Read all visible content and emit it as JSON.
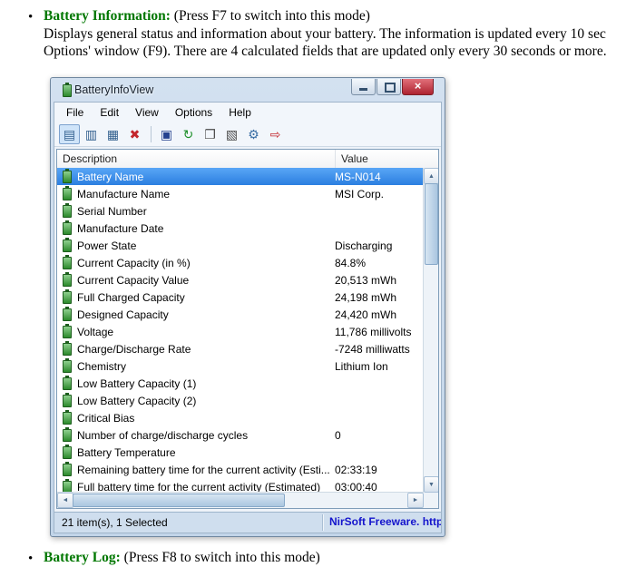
{
  "doc": {
    "bullet_glyph": "•",
    "bullet1_title": "Battery Information:",
    "bullet1_rest": " (Press F7 to switch into this mode)",
    "bullet1_line2": "Displays general status and information about your battery. The information is updated every 10 sec",
    "bullet1_line3": "Options' window (F9). There are 4 calculated fields that are updated only every 30 seconds or more.",
    "bullet2_title": "Battery Log:",
    "bullet2_rest": " (Press F8 to switch into this mode)"
  },
  "window": {
    "title": "BatteryInfoView",
    "menu": [
      "File",
      "Edit",
      "View",
      "Options",
      "Help"
    ],
    "toolbar_icons": [
      {
        "name": "report-view-icon",
        "glyph": "▤"
      },
      {
        "name": "item-view-icon",
        "glyph": "▥"
      },
      {
        "name": "choose-columns-icon",
        "glyph": "▦"
      },
      {
        "name": "delete-icon",
        "glyph": "✖"
      },
      {
        "name": "save-report-icon",
        "glyph": "▣"
      },
      {
        "name": "refresh-icon",
        "glyph": "↻"
      },
      {
        "name": "copy-icon",
        "glyph": "❐"
      },
      {
        "name": "paste-icon",
        "glyph": "▧"
      },
      {
        "name": "properties-icon",
        "glyph": "⚙"
      },
      {
        "name": "exit-icon",
        "glyph": "⇨"
      }
    ],
    "columns": {
      "description": "Description",
      "value": "Value"
    },
    "rows": [
      {
        "desc": "Battery Name",
        "value": "MS-N014",
        "selected": true
      },
      {
        "desc": "Manufacture Name",
        "value": "MSI Corp."
      },
      {
        "desc": "Serial Number",
        "value": ""
      },
      {
        "desc": "Manufacture Date",
        "value": ""
      },
      {
        "desc": "Power State",
        "value": "Discharging"
      },
      {
        "desc": "Current Capacity (in %)",
        "value": "84.8%"
      },
      {
        "desc": "Current Capacity Value",
        "value": "20,513 mWh"
      },
      {
        "desc": "Full Charged Capacity",
        "value": "24,198 mWh"
      },
      {
        "desc": "Designed Capacity",
        "value": "24,420 mWh"
      },
      {
        "desc": "Voltage",
        "value": "11,786 millivolts"
      },
      {
        "desc": "Charge/Discharge Rate",
        "value": "-7248 milliwatts"
      },
      {
        "desc": "Chemistry",
        "value": "Lithium Ion"
      },
      {
        "desc": "Low Battery Capacity (1)",
        "value": ""
      },
      {
        "desc": "Low Battery Capacity (2)",
        "value": ""
      },
      {
        "desc": "Critical Bias",
        "value": ""
      },
      {
        "desc": "Number of charge/discharge cycles",
        "value": "0"
      },
      {
        "desc": "Battery Temperature",
        "value": ""
      },
      {
        "desc": "Remaining battery time for the current activity (Esti...",
        "value": "02:33:19"
      },
      {
        "desc": "Full battery time for the current activity (Estimated)",
        "value": "03:00:40"
      }
    ],
    "status_left": "21 item(s), 1 Selected",
    "status_right": "NirSoft Freeware.  http"
  },
  "colors": {
    "doc_heading_green": "#007700",
    "selection_blue": "#2b7fe0",
    "close_button_red": "#ad2330",
    "status_link_blue": "#1414cc",
    "battery_icon_green": "#2c8a2c"
  }
}
